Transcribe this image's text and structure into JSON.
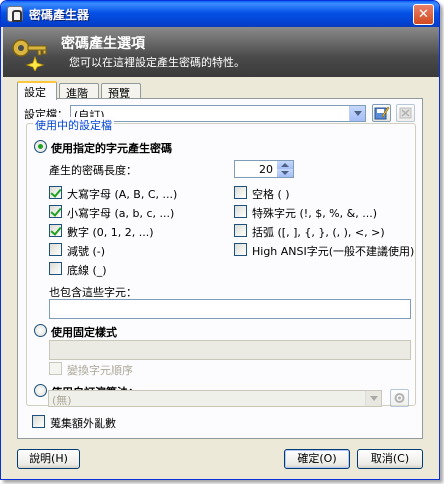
{
  "window": {
    "title": "密碼產生器",
    "close_glyph": "✕"
  },
  "banner": {
    "title": "密碼產生選項",
    "subtitle": "您可以在這裡設定產生密碼的特性。"
  },
  "tabs": [
    {
      "label": "設定",
      "active": true
    },
    {
      "label": "進階",
      "active": false
    },
    {
      "label": "預覽",
      "active": false
    }
  ],
  "profile": {
    "label": "設定檔：",
    "value": "(自訂)"
  },
  "group": {
    "title": "使用中的設定檔"
  },
  "charset": {
    "radio_label": "使用指定的字元產生密碼",
    "length_label": "產生的密碼長度：",
    "length_value": "20",
    "options_left": [
      {
        "label": "大寫字母 (A, B, C, ...)",
        "checked": true
      },
      {
        "label": "小寫字母 (a, b, c, ...)",
        "checked": true
      },
      {
        "label": "數字 (0, 1, 2, ...)",
        "checked": true
      },
      {
        "label": "減號 (-)",
        "checked": false
      },
      {
        "label": "底線 (_)",
        "checked": false
      }
    ],
    "options_right": [
      {
        "label": "空格 ( )",
        "checked": false
      },
      {
        "label": "特殊字元 (!, $, %, &, ...)",
        "checked": false
      },
      {
        "label": "括弧 ([, ], {, }, (, ), <, >)",
        "checked": false
      },
      {
        "label": "High ANSI字元(一般不建議使用)",
        "checked": false
      }
    ],
    "also_include_label": "也包含這些字元：",
    "also_include_value": ""
  },
  "pattern": {
    "radio_label": "使用固定樣式",
    "permute_label": "變換字元順序"
  },
  "algorithm": {
    "radio_label": "使用自訂演算法：",
    "value": "(無)"
  },
  "entropy_label": "蒐集額外亂數",
  "buttons": {
    "help": "說明(H)",
    "ok": "確定(O)",
    "cancel": "取消(C)"
  }
}
